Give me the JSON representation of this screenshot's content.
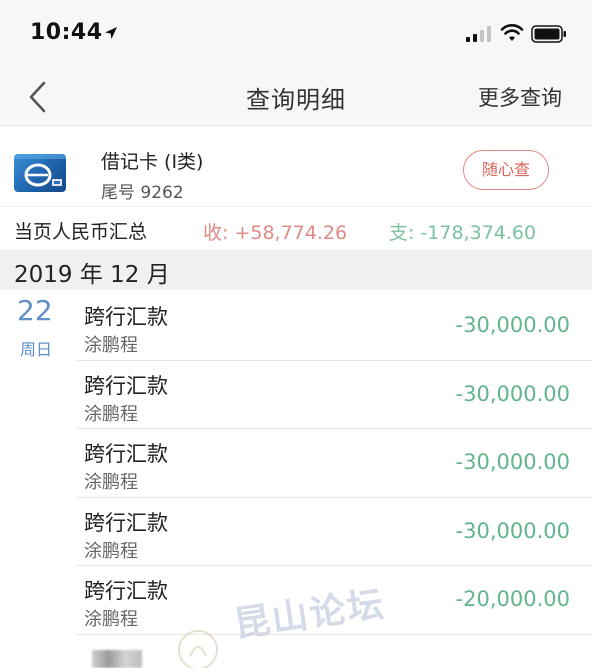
{
  "status_bar": {
    "time": "10:44"
  },
  "nav": {
    "title": "查询明细",
    "more_label": "更多查询"
  },
  "card": {
    "name": "借记卡 (I类)",
    "tail": "尾号 9262",
    "random_query_label": "随心查"
  },
  "summary": {
    "label": "当页人民币汇总",
    "income": "收: +58,774.26",
    "expense": "支: -178,374.60"
  },
  "month": "2019 年 12 月",
  "day": {
    "number": "22",
    "weekday": "周日"
  },
  "transactions": [
    {
      "title": "跨行汇款",
      "name": "涂鹏程",
      "amount": "-30,000.00"
    },
    {
      "title": "跨行汇款",
      "name": "涂鹏程",
      "amount": "-30,000.00"
    },
    {
      "title": "跨行汇款",
      "name": "涂鹏程",
      "amount": "-30,000.00"
    },
    {
      "title": "跨行汇款",
      "name": "涂鹏程",
      "amount": "-30,000.00"
    },
    {
      "title": "跨行汇款",
      "name": "涂鹏程",
      "amount": "-20,000.00"
    }
  ],
  "watermark": "昆山论坛",
  "colors": {
    "income": "#e08a84",
    "expense": "#62b58c",
    "date_accent": "#5e8fc9",
    "random_query_border": "#e58a82"
  }
}
